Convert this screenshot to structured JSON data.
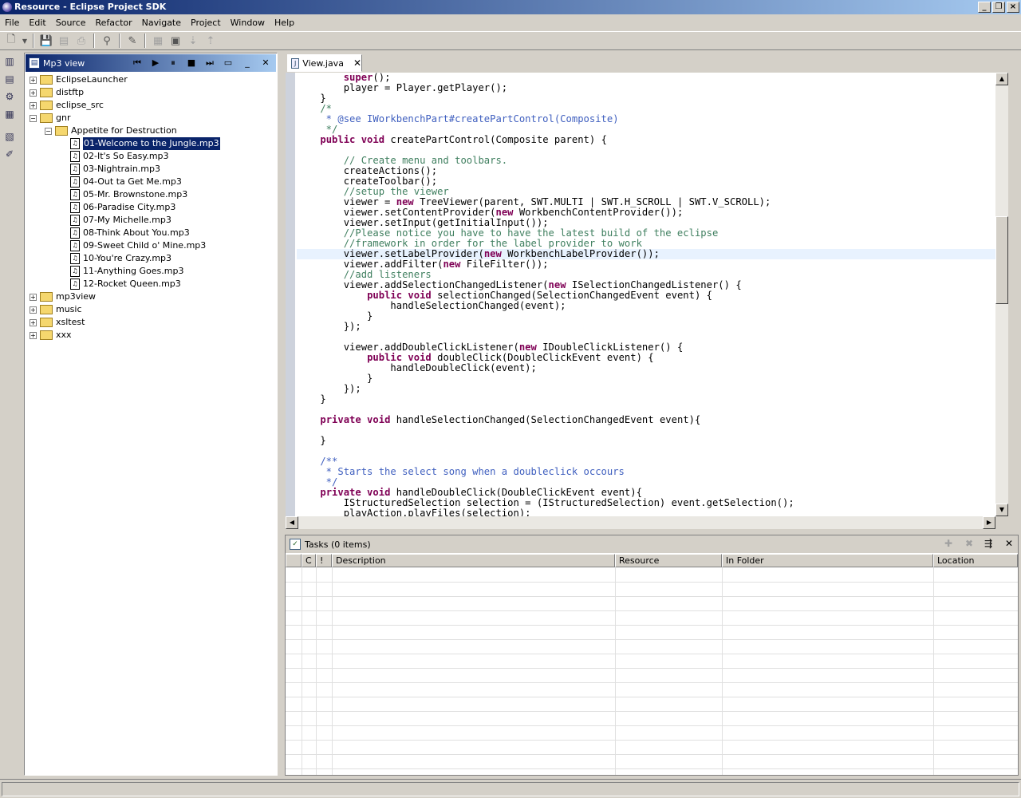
{
  "window": {
    "title": "Resource - Eclipse Project SDK"
  },
  "menu": [
    "File",
    "Edit",
    "Source",
    "Refactor",
    "Navigate",
    "Project",
    "Window",
    "Help"
  ],
  "mp3view": {
    "title": "Mp3 view",
    "tree": [
      {
        "label": "EclipseLauncher",
        "depth": 0,
        "expanded": false,
        "kind": "folder"
      },
      {
        "label": "distftp",
        "depth": 0,
        "expanded": false,
        "kind": "folder"
      },
      {
        "label": "eclipse_src",
        "depth": 0,
        "expanded": false,
        "kind": "folder"
      },
      {
        "label": "gnr",
        "depth": 0,
        "expanded": true,
        "kind": "folder"
      },
      {
        "label": "Appetite for Destruction",
        "depth": 1,
        "expanded": true,
        "kind": "folder-open"
      },
      {
        "label": "01-Welcome to the Jungle.mp3",
        "depth": 2,
        "kind": "file",
        "selected": true
      },
      {
        "label": "02-It's So Easy.mp3",
        "depth": 2,
        "kind": "file"
      },
      {
        "label": "03-Nightrain.mp3",
        "depth": 2,
        "kind": "file"
      },
      {
        "label": "04-Out ta Get Me.mp3",
        "depth": 2,
        "kind": "file"
      },
      {
        "label": "05-Mr. Brownstone.mp3",
        "depth": 2,
        "kind": "file"
      },
      {
        "label": "06-Paradise City.mp3",
        "depth": 2,
        "kind": "file"
      },
      {
        "label": "07-My Michelle.mp3",
        "depth": 2,
        "kind": "file"
      },
      {
        "label": "08-Think About You.mp3",
        "depth": 2,
        "kind": "file"
      },
      {
        "label": "09-Sweet Child o' Mine.mp3",
        "depth": 2,
        "kind": "file"
      },
      {
        "label": "10-You're Crazy.mp3",
        "depth": 2,
        "kind": "file"
      },
      {
        "label": "11-Anything Goes.mp3",
        "depth": 2,
        "kind": "file"
      },
      {
        "label": "12-Rocket Queen.mp3",
        "depth": 2,
        "kind": "file"
      },
      {
        "label": "mp3view",
        "depth": 0,
        "expanded": false,
        "kind": "folder"
      },
      {
        "label": "music",
        "depth": 0,
        "expanded": false,
        "kind": "folder"
      },
      {
        "label": "xsltest",
        "depth": 0,
        "expanded": false,
        "kind": "folder"
      },
      {
        "label": "xxx",
        "depth": 0,
        "expanded": false,
        "kind": "folder"
      }
    ]
  },
  "editor": {
    "tab": "View.java",
    "lines": [
      [
        [
          "        ",
          ""
        ],
        [
          "super",
          "kw"
        ],
        [
          "();",
          ""
        ]
      ],
      [
        [
          "        player = Player.getPlayer();",
          ""
        ]
      ],
      [
        [
          "    }",
          ""
        ]
      ],
      [
        [
          "    /*",
          "cm"
        ]
      ],
      [
        [
          "     * @see IWorkbenchPart#createPartControl(Composite)",
          "jd"
        ]
      ],
      [
        [
          "     */",
          "cm"
        ]
      ],
      [
        [
          "    ",
          ""
        ],
        [
          "public void",
          "kw"
        ],
        [
          " createPartControl(Composite parent) {",
          ""
        ]
      ],
      [
        [
          "",
          ""
        ]
      ],
      [
        [
          "        // Create menu and toolbars.",
          "cm"
        ]
      ],
      [
        [
          "        createActions();",
          ""
        ]
      ],
      [
        [
          "        createToolbar();",
          ""
        ]
      ],
      [
        [
          "        //setup the viewer",
          "cm"
        ]
      ],
      [
        [
          "        viewer = ",
          ""
        ],
        [
          "new",
          "kw"
        ],
        [
          " TreeViewer(parent, SWT.MULTI | SWT.H_SCROLL | SWT.V_SCROLL);",
          ""
        ]
      ],
      [
        [
          "        viewer.setContentProvider(",
          ""
        ],
        [
          "new",
          "kw"
        ],
        [
          " WorkbenchContentProvider());",
          ""
        ]
      ],
      [
        [
          "        viewer.setInput(getInitialInput());",
          ""
        ]
      ],
      [
        [
          "        //Please notice you have to have the latest build of the eclipse",
          "cm"
        ]
      ],
      [
        [
          "        //framework in order for the label provider to work",
          "cm"
        ]
      ],
      [
        [
          "        viewer.setLabelProvider(",
          ""
        ],
        [
          "new",
          "kw"
        ],
        [
          " WorkbenchLabelProvider());",
          ""
        ]
      ],
      [
        [
          "        viewer.addFilter(",
          ""
        ],
        [
          "new",
          "kw"
        ],
        [
          " FileFilter());",
          ""
        ]
      ],
      [
        [
          "        //add listeners",
          "cm"
        ]
      ],
      [
        [
          "        viewer.addSelectionChangedListener(",
          ""
        ],
        [
          "new",
          "kw"
        ],
        [
          " ISelectionChangedListener() {",
          ""
        ]
      ],
      [
        [
          "            ",
          ""
        ],
        [
          "public void",
          "kw"
        ],
        [
          " selectionChanged(SelectionChangedEvent event) {",
          ""
        ]
      ],
      [
        [
          "                handleSelectionChanged(event);",
          ""
        ]
      ],
      [
        [
          "            }",
          ""
        ]
      ],
      [
        [
          "        });",
          ""
        ]
      ],
      [
        [
          "",
          ""
        ]
      ],
      [
        [
          "        viewer.addDoubleClickListener(",
          ""
        ],
        [
          "new",
          "kw"
        ],
        [
          " IDoubleClickListener() {",
          ""
        ]
      ],
      [
        [
          "            ",
          ""
        ],
        [
          "public void",
          "kw"
        ],
        [
          " doubleClick(DoubleClickEvent event) {",
          ""
        ]
      ],
      [
        [
          "                handleDoubleClick(event);",
          ""
        ]
      ],
      [
        [
          "            }",
          ""
        ]
      ],
      [
        [
          "        });",
          ""
        ]
      ],
      [
        [
          "    }",
          ""
        ]
      ],
      [
        [
          "",
          ""
        ]
      ],
      [
        [
          "    ",
          ""
        ],
        [
          "private void",
          "kw"
        ],
        [
          " handleSelectionChanged(SelectionChangedEvent event){",
          ""
        ]
      ],
      [
        [
          "",
          ""
        ]
      ],
      [
        [
          "    }",
          ""
        ]
      ],
      [
        [
          "",
          ""
        ]
      ],
      [
        [
          "    /**",
          "jd"
        ]
      ],
      [
        [
          "     * Starts the select song when a doubleclick occours",
          "jd"
        ]
      ],
      [
        [
          "     */",
          "jd"
        ]
      ],
      [
        [
          "    ",
          ""
        ],
        [
          "private void",
          "kw"
        ],
        [
          " handleDoubleClick(DoubleClickEvent event){",
          ""
        ]
      ],
      [
        [
          "        IStructuredSelection selection = (IStructuredSelection) event.getSelection();",
          ""
        ]
      ],
      [
        [
          "        playAction.playFiles(selection);",
          ""
        ]
      ]
    ]
  },
  "tasks": {
    "title": "Tasks (0 items)",
    "columns": [
      "C",
      "!",
      "Description",
      "Resource",
      "In Folder",
      "Location"
    ]
  }
}
